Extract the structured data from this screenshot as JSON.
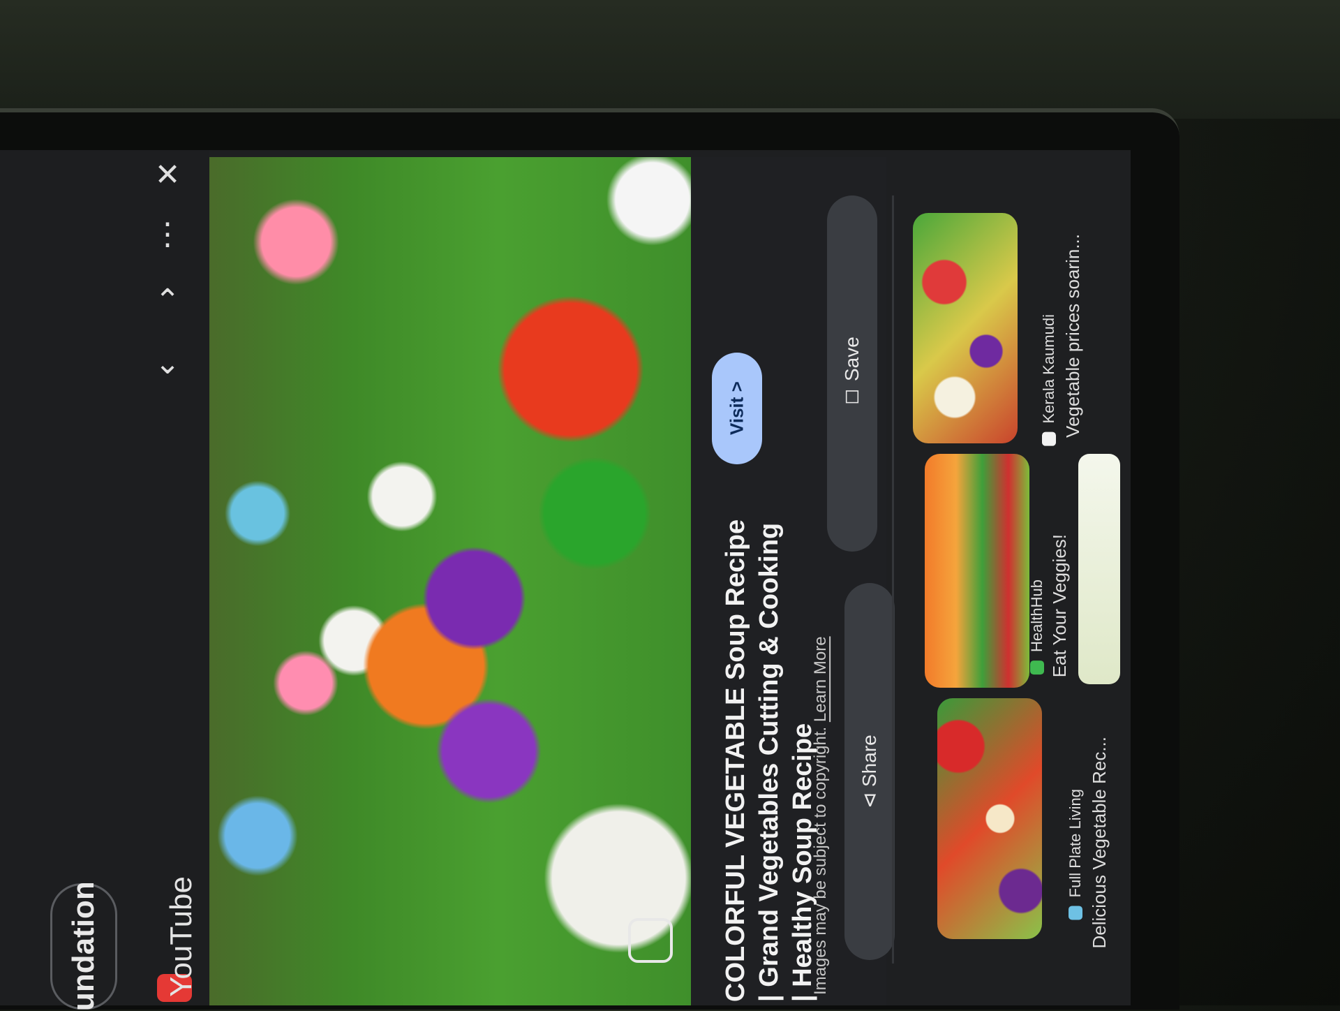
{
  "app": {
    "chip_label": "undation",
    "source_name": "YouTube"
  },
  "toolbar": {
    "prev_icon": "chevron-down-icon",
    "next_icon": "chevron-up-icon",
    "more_icon": "more-vert-icon",
    "close_icon": "close-icon"
  },
  "result": {
    "title": "COLORFUL VEGETABLE Soup Recipe | Grand Vegetables Cutting & Cooking | Healthy Soup Recipe",
    "copyright": "Images may be subject to copyright.",
    "learn_more": "Learn More",
    "visit_label": "Visit >",
    "share_label": "Share",
    "save_label": "Save"
  },
  "related": [
    {
      "source": "Kerala Kaumudi",
      "title": "Vegetable prices soarin...",
      "dot_color": "#f2f2f2"
    },
    {
      "source": "HealthHub",
      "title": "Eat Your Veggies!",
      "dot_color": "#3fb950"
    },
    {
      "source": "Full Plate Living",
      "title": "Delicious Vegetable Rec...",
      "dot_color": "#6ec1e4"
    }
  ],
  "colors": {
    "accent": "#a9c7fb",
    "background": "#1f2023"
  }
}
